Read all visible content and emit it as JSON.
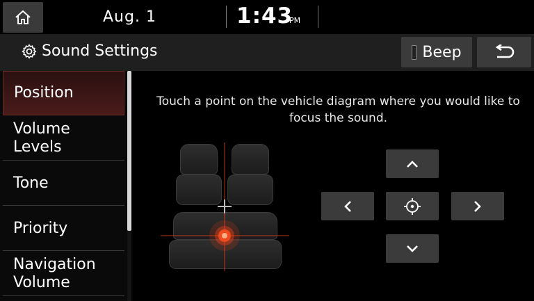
{
  "status_bar": {
    "date": "Aug.  1",
    "time": "1:43",
    "ampm": "PM"
  },
  "title_bar": {
    "title": "Sound Settings",
    "beep_label": "Beep"
  },
  "sidebar": {
    "items": [
      {
        "label": "Position",
        "selected": true
      },
      {
        "label": "Volume Levels",
        "selected": false
      },
      {
        "label": "Tone",
        "selected": false
      },
      {
        "label": "Priority",
        "selected": false
      },
      {
        "label": "Navigation Volume",
        "selected": false
      }
    ]
  },
  "main": {
    "instruction": "Touch a point on the vehicle diagram where you would like to focus the sound."
  },
  "icons": {
    "home": "home-icon",
    "settings": "gear-icon",
    "back": "back-arrow-icon",
    "up": "chevron-up-icon",
    "down": "chevron-down-icon",
    "left": "chevron-left-icon",
    "right": "chevron-right-icon",
    "center": "crosshair-icon"
  },
  "colors": {
    "accent": "#e8401a",
    "selected_bg": "#4a1c1a",
    "button_bg": "#3b3b3b"
  }
}
